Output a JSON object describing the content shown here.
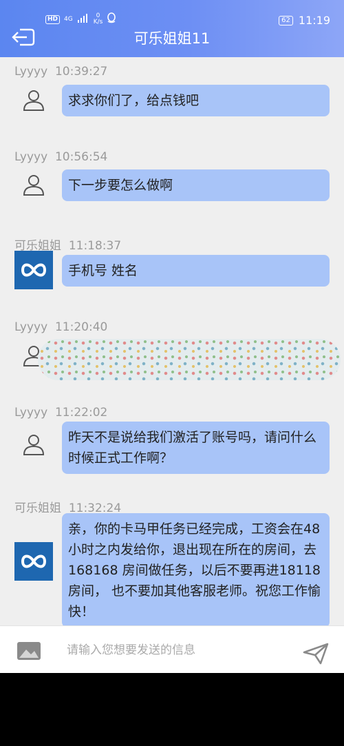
{
  "status_bar": {
    "hd": "HD",
    "network": "4G",
    "speed_value": "0",
    "speed_unit": "K/s",
    "battery": "62",
    "time": "11:19"
  },
  "header": {
    "title": "可乐姐姐11"
  },
  "messages": [
    {
      "sender": "Lyyyy",
      "time": "10:39:27",
      "text": "求求你们了，给点钱吧",
      "avatar": "user-icon"
    },
    {
      "sender": "Lyyyy",
      "time": "10:56:54",
      "text": "下一步要怎么做啊",
      "avatar": "user-icon"
    },
    {
      "sender": "可乐姐姐",
      "time": "11:18:37",
      "text": "手机号 姓名",
      "avatar": "logo-icon"
    },
    {
      "sender": "Lyyyy",
      "time": "11:20:40",
      "text": "",
      "avatar": "user-icon"
    },
    {
      "sender": "Lyyyy",
      "time": "11:22:02",
      "text": "昨天不是说给我们激活了账号吗，请问什么时候正式工作啊？",
      "avatar": "user-icon"
    },
    {
      "sender": "可乐姐姐",
      "time": "11:32:24",
      "text": "亲，你的卡马甲任务已经完成，工资会在48小时之内发给你，退出现在所在的房间，去 168168 房间做任务，以后不要再进18118房间， 也不要加其他客服老师。祝您工作愉快！",
      "avatar": "logo-icon"
    }
  ],
  "input": {
    "placeholder": "请输入您想要发送的信息"
  },
  "colors": {
    "header": "#6d8ff4",
    "bubble": "#a8c4f8",
    "background": "#efefef"
  }
}
